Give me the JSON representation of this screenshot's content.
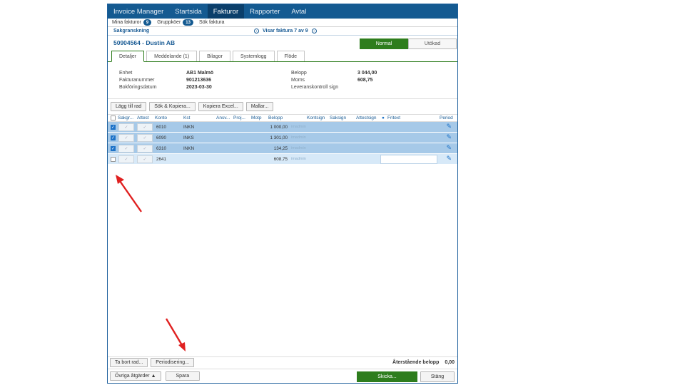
{
  "nav": {
    "items": [
      "Invoice Manager",
      "Startsida",
      "Fakturor",
      "Rapporter",
      "Avtal"
    ],
    "active": "Fakturor"
  },
  "subnav": {
    "my_invoices": "Mina fakturor",
    "my_invoices_count": "9",
    "group_queues": "Gruppköer",
    "group_queues_count": "13",
    "search_invoice": "Sök faktura"
  },
  "section": {
    "label": "Sakgranskning",
    "showing": "Visar faktura 7 av 9",
    "prev_icon": "chevron-left-circle-icon",
    "next_icon": "chevron-right-circle-icon"
  },
  "invoice": {
    "title": "50904564 - Dustin AB",
    "view_normal": "Normal",
    "view_extended": "Utökad"
  },
  "tabs": [
    "Detaljer",
    "Meddelande (1)",
    "Bilagor",
    "Systemlogg",
    "Flöde"
  ],
  "details": {
    "unit_label": "Enhet",
    "unit_value": "AB1 Malmö",
    "invoice_no_label": "Fakturanummer",
    "invoice_no_value": "901213636",
    "booking_date_label": "Bokföringsdatum",
    "booking_date_value": "2023-03-30",
    "amount_label": "Belopp",
    "amount_value": "3 044,00",
    "vat_label": "Moms",
    "vat_value": "608,75",
    "delivery_check_label": "Leveranskontroll sign"
  },
  "toolbar": {
    "add_row": "Lägg till rad",
    "search_copy": "Sök & Kopiera...",
    "copy_excel": "Kopiera Excel...",
    "templates": "Mallar..."
  },
  "grid": {
    "headers": [
      "Sakgr...",
      "Attest",
      "Konto",
      "Kst",
      "Ansv...",
      "Proj...",
      "Motp",
      "Belopp",
      "Kontsign",
      "Saksign",
      "Attestsign",
      "Fritext",
      "Period"
    ],
    "rows": [
      {
        "checked": true,
        "konto": "6010",
        "kst": "INKN",
        "belopp": "1 000,00",
        "sign": "imadmin"
      },
      {
        "checked": true,
        "konto": "6090",
        "kst": "INKS",
        "belopp": "1 301,00",
        "sign": "imadmin"
      },
      {
        "checked": true,
        "konto": "6310",
        "kst": "INKN",
        "belopp": "134,25",
        "sign": "imadmin"
      },
      {
        "checked": false,
        "konto": "2641",
        "kst": "",
        "belopp": "608,75",
        "sign": "imadmin"
      }
    ]
  },
  "footer": {
    "delete_row": "Ta bort rad...",
    "periodize": "Periodisering...",
    "remaining_label": "Återstående belopp",
    "remaining_value": "0,00",
    "other_actions": "Övriga åtgärder ▲",
    "save": "Spara",
    "send": "Skicka...",
    "close": "Stäng"
  },
  "colors": {
    "nav_bg": "#145a91",
    "accent_green": "#2e7d1d",
    "row_selected": "#a6c9e8",
    "annotation_arrow": "#e02020"
  }
}
